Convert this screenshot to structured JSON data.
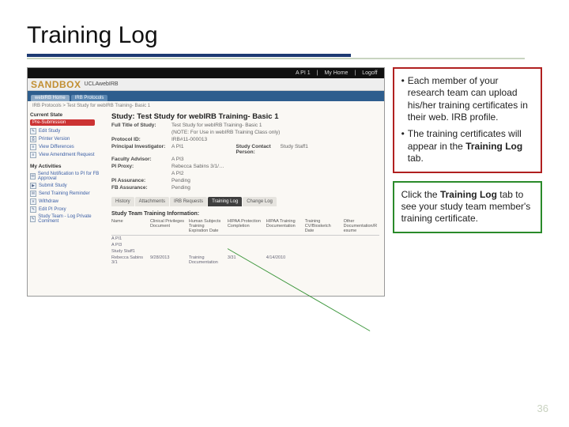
{
  "title": "Training Log",
  "topbar": {
    "user": "A PI 1",
    "home": "My Home",
    "logoff": "Logoff"
  },
  "sandbox": {
    "logo": "SANDBOX",
    "sub": "UCLAwebIRB"
  },
  "irb_tabs": [
    "webIRB Home",
    "IRB Protocols"
  ],
  "breadcrumb": "IRB Protocols > Test Study for webIRB Training- Basic 1",
  "sidebar": {
    "current_state": "Current State",
    "red_button": "Pre-Submission",
    "state_items": [
      "Edit Study",
      "Printer Version",
      "View Differences",
      "View Amendment Request"
    ],
    "activities_head": "My Activities",
    "activities": [
      "Send Notification to PI for FB Approval",
      "Submit Study",
      "Send Training Reminder",
      "Withdraw",
      "Edit PI Proxy",
      "Study Team - Log Private Comment"
    ]
  },
  "study": {
    "title": "Study: Test Study for webIRB Training- Basic 1",
    "full_title_label": "Full Title of Study:",
    "full_title_value": "Test Study for webIRB Training- Basic 1",
    "note": "(NOTE: For Use in webIRB Training Class only)",
    "pid_label": "Protocol ID:",
    "pid_value": "IRB#11-000013",
    "pi_label": "Principal Investigator:",
    "pi_value": "A PI1",
    "sc_label": "Study Contact Person:",
    "sc_value": "Study Staff1",
    "fa_label": "Faculty Advisor:",
    "fa_value": "A PI3",
    "proxy_label": "PI Proxy:",
    "proxy_value": "Rebecca Sabins 3/1/…",
    "proxy_value2": "A PI2",
    "assur_label": "PI Assurance:",
    "assur_value": "Pending",
    "fb_label": "FB Assurance:",
    "fb_value": "Pending"
  },
  "tabs": [
    "History",
    "Attachments",
    "IRB Requests",
    "Training Log",
    "Change Log"
  ],
  "active_tab_index": 3,
  "table": {
    "heading": "Study Team Training Information:",
    "cols": [
      "Name",
      "Clinical Privileges Document",
      "Human Subjects Training Expiration Date",
      "HIPAA Protection Completion",
      "HIPAA Training Documentation",
      "Training CV/Biosketch Date",
      "Other Documentation/Resume"
    ],
    "rows": [
      {
        "name": "A PI1"
      },
      {
        "name": "A PI3"
      },
      {
        "name": "Study Staff1"
      },
      {
        "name": "Rebecca Sabins 3/1",
        "col2": "9/28/2013",
        "col3": "Training Documentation",
        "col4": "3/31",
        "col5": "4/14/2010"
      }
    ]
  },
  "right": {
    "box1_bullet1": "Each member of your research team can upload his/her training certificates in their web. IRB profile.",
    "box1_bullet2_a": "The training certificates will appear in the ",
    "box1_bullet2_bold": "Training Log",
    "box1_bullet2_b": " tab.",
    "box2_a": "Click the ",
    "box2_bold": "Training Log",
    "box2_b": " tab to see your study team member's training certificate."
  },
  "page_number": "36"
}
